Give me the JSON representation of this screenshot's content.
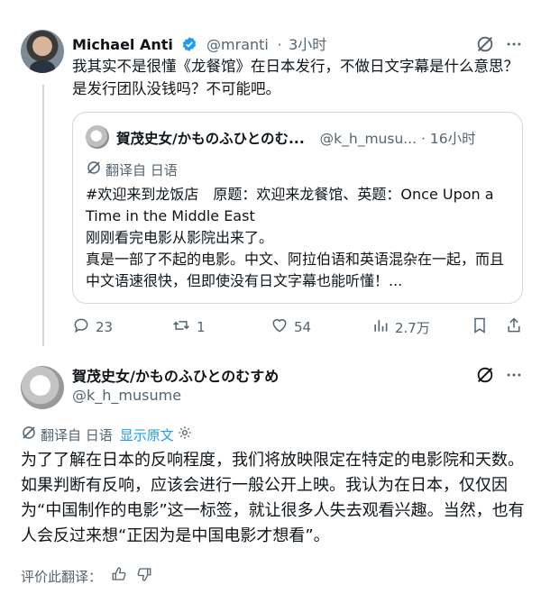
{
  "main_tweet": {
    "author_name": "Michael Anti",
    "handle": "@mranti",
    "separator": "·",
    "time": "3小时",
    "text": "我其实不是很懂《龙餐馆》在日本发行，不做日文字幕是什么意思？是发行团队没钱吗？不可能吧。",
    "quote": {
      "author_name": "賀茂史女/かものふひとのむ...",
      "handle": "@k_h_musu...",
      "separator": "·",
      "time": "16小时",
      "translated_label": "翻译自 日语",
      "text": "#欢迎来到龙饭店　原题：欢迎来龙餐馆、英题：Once Upon a Time in the Middle East\n刚刚看完电影从影院出来了。\n真是一部了不起的电影。中文、阿拉伯语和英语混杂在一起，而且中文语速很快，但即使没有日文字幕也能听懂！..."
    },
    "actions": {
      "replies": "23",
      "retweets": "1",
      "likes": "54",
      "views": "2.7万"
    }
  },
  "reply": {
    "author_name": "賀茂史女/かものふひとのむすめ",
    "handle": "@k_h_musume",
    "translated_label": "翻译自 日语",
    "show_original": "显示原文",
    "text": "为了了解在日本的反响程度，我们将放映限定在特定的电影院和天数。如果判断有反响，应该会进行一般公开上映。我认为在日本，仅仅因为“中国制作的电影”这一标签，就让很多人失去观看兴趣。当然，也有人会反过来想“正因为是中国电影才想看”。",
    "rate_label": "评价此翻译："
  },
  "colors": {
    "accent": "#1d9bf0",
    "muted": "#536471",
    "border": "#cfd9de",
    "text": "#0f1419"
  }
}
